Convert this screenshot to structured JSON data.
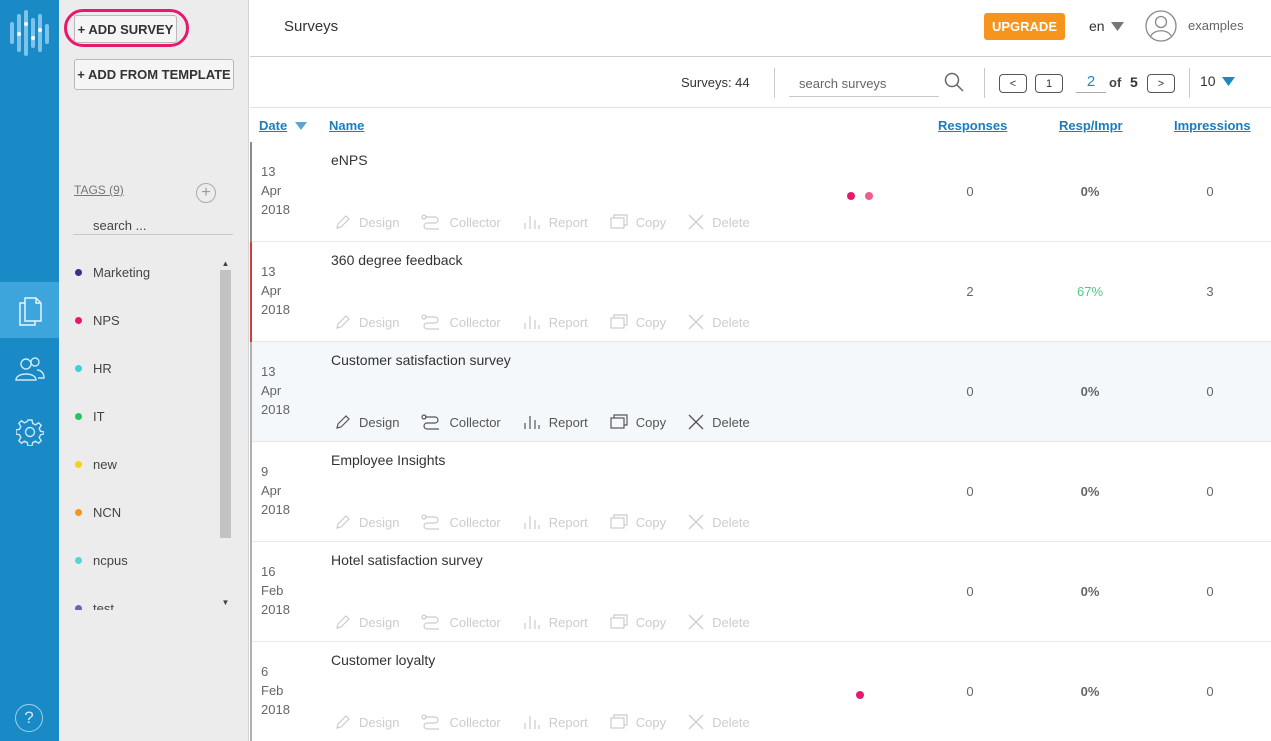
{
  "sidebar": {
    "add_survey": "+ ADD SURVEY",
    "add_from_template": "+ ADD FROM TEMPLATE",
    "tags_label": "TAGS (9)",
    "tag_search_placeholder": "search ...",
    "tags": [
      {
        "name": "Marketing",
        "color": "#3b2e91"
      },
      {
        "name": "NPS",
        "color": "#e8196c"
      },
      {
        "name": "HR",
        "color": "#3ad1d8"
      },
      {
        "name": "IT",
        "color": "#22c55e"
      },
      {
        "name": "new",
        "color": "#f5d312"
      },
      {
        "name": "NCN",
        "color": "#f7941d"
      },
      {
        "name": "ncpus",
        "color": "#52d6d6"
      },
      {
        "name": "test",
        "color": "#7a5cc0"
      }
    ]
  },
  "header": {
    "title": "Surveys",
    "upgrade": "UPGRADE",
    "language": "en",
    "username": "examples"
  },
  "toolbar": {
    "count_label": "Surveys: 44",
    "search_placeholder": "search surveys",
    "prev": "<",
    "first": "1",
    "current_page": "2",
    "of": "of",
    "total_pages": "5",
    "next": ">",
    "per_page": "10"
  },
  "table": {
    "columns": {
      "date": "Date",
      "name": "Name",
      "responses": "Responses",
      "resp_impr": "Resp/Impr",
      "impressions": "Impressions"
    },
    "actions": {
      "design": "Design",
      "collector": "Collector",
      "report": "Report",
      "copy": "Copy",
      "delete": "Delete"
    },
    "rows": [
      {
        "day": "13",
        "month": "Apr",
        "year": "2018",
        "name": "eNPS",
        "responses": "0",
        "resp_impr": "0%",
        "impressions": "0"
      },
      {
        "day": "13",
        "month": "Apr",
        "year": "2018",
        "name": "360 degree feedback",
        "responses": "2",
        "resp_impr": "67%",
        "impressions": "3"
      },
      {
        "day": "13",
        "month": "Apr",
        "year": "2018",
        "name": "Customer satisfaction survey",
        "responses": "0",
        "resp_impr": "0%",
        "impressions": "0"
      },
      {
        "day": "9",
        "month": "Apr",
        "year": "2018",
        "name": "Employee Insights",
        "responses": "0",
        "resp_impr": "0%",
        "impressions": "0"
      },
      {
        "day": "16",
        "month": "Feb",
        "year": "2018",
        "name": "Hotel satisfaction survey",
        "responses": "0",
        "resp_impr": "0%",
        "impressions": "0"
      },
      {
        "day": "6",
        "month": "Feb",
        "year": "2018",
        "name": "Customer loyalty",
        "responses": "0",
        "resp_impr": "0%",
        "impressions": "0"
      }
    ]
  },
  "colors": {
    "rail": "#1a8ac6",
    "accent": "#1a7dc0",
    "upgrade": "#f7941d",
    "highlight": "#e8196c",
    "positive": "#4cc98a"
  }
}
